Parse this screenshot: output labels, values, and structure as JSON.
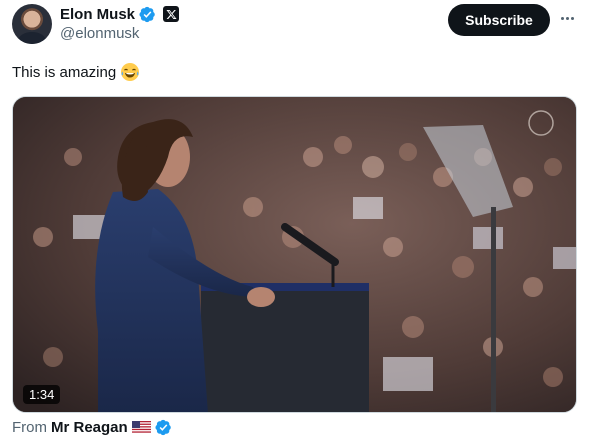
{
  "author": {
    "name": "Elon Musk",
    "handle": "@elonmusk"
  },
  "actions": {
    "subscribe_label": "Subscribe"
  },
  "tweet": {
    "text": "This is amazing",
    "emoji": "face-with-tears-of-joy"
  },
  "media": {
    "duration": "1:34"
  },
  "source": {
    "from_label": "From",
    "name": "Mr Reagan"
  },
  "colors": {
    "verified": "#1d9bf0",
    "text_primary": "#0f1419",
    "text_secondary": "#536471",
    "button_bg": "#0f1419"
  }
}
